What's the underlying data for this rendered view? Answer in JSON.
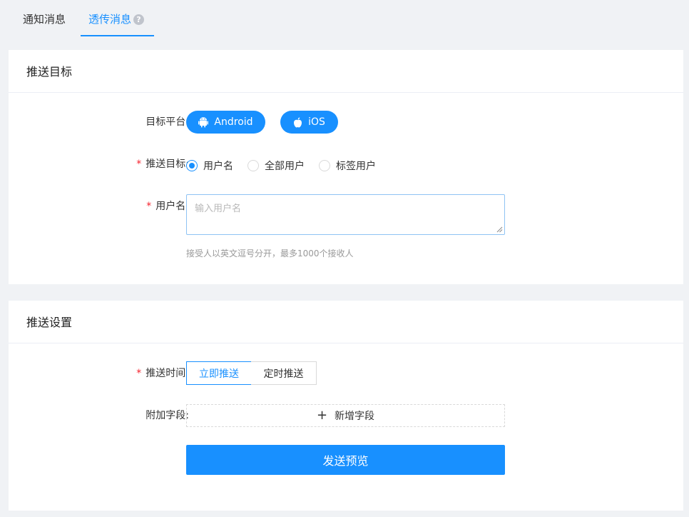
{
  "tabs": {
    "notify": "通知消息",
    "passthrough": "透传消息",
    "help_icon": "?"
  },
  "target_card": {
    "title": "推送目标",
    "platform_label": "目标平台:",
    "platforms": {
      "android": "Android",
      "ios": "iOS"
    },
    "target_label": "推送目标:",
    "targets": [
      {
        "label": "用户名",
        "checked": true
      },
      {
        "label": "全部用户",
        "checked": false
      },
      {
        "label": "标签用户",
        "checked": false
      }
    ],
    "username_label": "用户名:",
    "username_placeholder": "输入用户名",
    "username_value": "",
    "hint": "接受人以英文逗号分开，最多1000个接收人"
  },
  "settings_card": {
    "title": "推送设置",
    "time_label": "推送时间:",
    "time_options": {
      "now": "立即推送",
      "timed": "定时推送"
    },
    "extra_label": "附加字段:",
    "add_field": "新增字段",
    "add_icon": "+",
    "send_preview": "发送预览"
  },
  "required_mark": "*",
  "colors": {
    "accent": "#1890ff",
    "required": "#f5222d"
  },
  "icons": {
    "android": "android-icon",
    "ios": "apple-icon"
  }
}
